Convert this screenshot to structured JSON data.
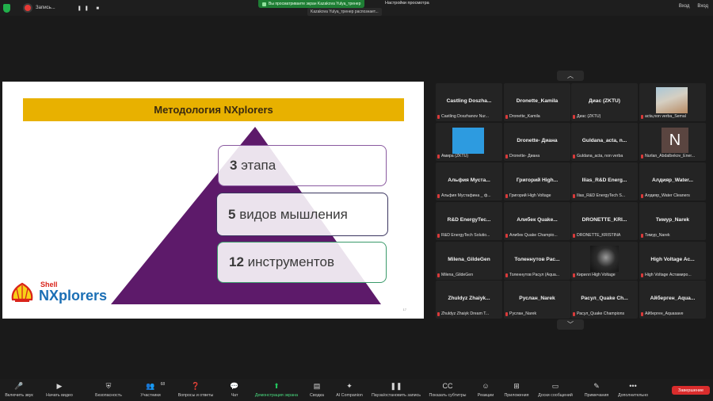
{
  "topbar": {
    "recording_label": "Запись...",
    "recording_controls": "❚❚ ■",
    "share_banner": "Вы просматриваете экран Kazakova Yulya_тренер",
    "view_options": "Настройки просмотра",
    "presenter_tag": "Kazakova Yulya_тренер распознает...",
    "enter_label": "Вход",
    "fullscreen_label": "Вход"
  },
  "slide": {
    "title": "Методология NXplorers",
    "items": [
      {
        "num": "3",
        "text": "этапа"
      },
      {
        "num": "5",
        "text": "видов мышления"
      },
      {
        "num": "12",
        "text": "инструментов"
      }
    ],
    "logo_small": "Shell",
    "logo_big": "NXplorers",
    "page_number": "17",
    "colors": {
      "title_bar": "#e8b100",
      "pyramid": "#5d1a6a"
    }
  },
  "participants": [
    {
      "name": "Castling  Doszha...",
      "sub": "Castling Doszhanov Nur..."
    },
    {
      "name": "Dronette_Kamila",
      "sub": "Dronette_Kamila"
    },
    {
      "name": "Диас (ZKTU)",
      "sub": "Диас (ZKTU)"
    },
    {
      "name": "",
      "sub": "acta,non verba_Semal",
      "thumb": "photo"
    },
    {
      "name": "",
      "sub": "Амира (ZKTU)",
      "thumb": "blue"
    },
    {
      "name": "Dronette- Диана",
      "sub": "Dronette- Диана"
    },
    {
      "name": "Guldana_acta,  n...",
      "sub": "Guldana_acta, non verba"
    },
    {
      "name": "",
      "sub": "Nurlan_Abdalbekov_Ener...",
      "thumb": "letter",
      "letter": "N"
    },
    {
      "name": "Альфия  Муста...",
      "sub": "Альфия Мустафина _ ф..."
    },
    {
      "name": "Григорий  High...",
      "sub": "Григорий High Voltage"
    },
    {
      "name": "Ilias_R&D  Energ...",
      "sub": "Ilias_R&D EnergyTech S..."
    },
    {
      "name": "Алдияр_Water...",
      "sub": "Алдияр_Water Cleaners"
    },
    {
      "name": "R&D  EnergyTec...",
      "sub": "R&D EnergyTech Solutio..."
    },
    {
      "name": "Алибек  Quake...",
      "sub": "Алибек Quake Champio..."
    },
    {
      "name": "DRONETTE_KRI...",
      "sub": "DRONETTE_KRISTINA"
    },
    {
      "name": "Тимур_Narek",
      "sub": "Тимур_Narek"
    },
    {
      "name": "Milena_GildeGen",
      "sub": "Milena_GildeGen"
    },
    {
      "name": "Толеннутов  Рас...",
      "sub": "Толеннутов Расул (Aqua..."
    },
    {
      "name": "",
      "sub": "Кирилл High Voltage",
      "thumb": "dark"
    },
    {
      "name": "High  Voltage  Ac...",
      "sub": "High Voltage Астамиро..."
    },
    {
      "name": "Zhuldyz  Zhaiyk...",
      "sub": "Zhuldyz Zhaiyk Dream T..."
    },
    {
      "name": "Руслан_Narek",
      "sub": "Руслан_Narek"
    },
    {
      "name": "Расул_Quake  Ch...",
      "sub": "Расул_Quake Champions"
    },
    {
      "name": "Айберген_Aqua...",
      "sub": "Айберген_Aquasave"
    }
  ],
  "toolbar": {
    "items": [
      {
        "label": "Включить звук",
        "icon": "mic-off-icon",
        "glyph": "🎤"
      },
      {
        "label": "Начать видео",
        "icon": "video-off-icon",
        "glyph": "▶"
      },
      {
        "label": "Безопасность",
        "icon": "shield-icon",
        "glyph": "⛨"
      },
      {
        "label": "Участники",
        "icon": "participants-icon",
        "glyph": "👥",
        "count": "68"
      },
      {
        "label": "Вопросы и ответы",
        "icon": "qa-icon",
        "glyph": "❓"
      },
      {
        "label": "Чат",
        "icon": "chat-icon",
        "glyph": "💬"
      },
      {
        "label": "Демонстрация экрана",
        "icon": "share-screen-icon",
        "glyph": "⬆"
      },
      {
        "label": "Сводка",
        "icon": "summary-icon",
        "glyph": "▤"
      },
      {
        "label": "AI Companion",
        "icon": "ai-companion-icon",
        "glyph": "✦"
      },
      {
        "label": "Пауза/остановить запись",
        "icon": "pause-record-icon",
        "glyph": "❚❚"
      },
      {
        "label": "Показать субтитры",
        "icon": "cc-icon",
        "glyph": "CC"
      },
      {
        "label": "Реакции",
        "icon": "reactions-icon",
        "glyph": "☺"
      },
      {
        "label": "Приложения",
        "icon": "apps-icon",
        "glyph": "⊞"
      },
      {
        "label": "Доски сообщений",
        "icon": "whiteboards-icon",
        "glyph": "▭"
      },
      {
        "label": "Примечания",
        "icon": "notes-icon",
        "glyph": "✎"
      },
      {
        "label": "Дополнительно",
        "icon": "more-icon",
        "glyph": "•••"
      }
    ],
    "end_label": "Завершение"
  }
}
